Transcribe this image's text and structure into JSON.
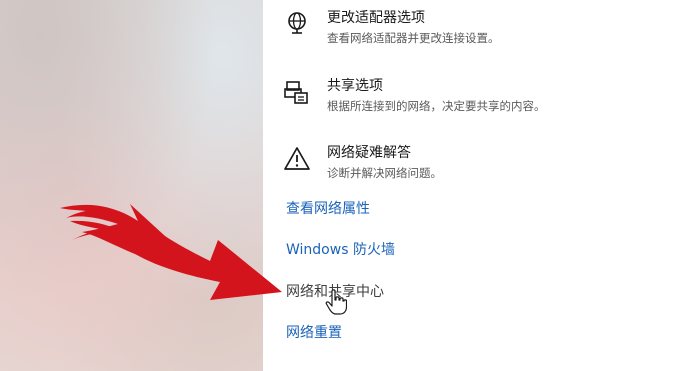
{
  "options": [
    {
      "icon": "network-adapter-globe-icon",
      "title": "更改适配器选项",
      "desc": "查看网络适配器并更改连接设置。"
    },
    {
      "icon": "sharing-printer-icon",
      "title": "共享选项",
      "desc": "根据所连接到的网络，决定要共享的内容。"
    },
    {
      "icon": "warning-triangle-icon",
      "title": "网络疑难解答",
      "desc": "诊断并解决网络问题。"
    }
  ],
  "links": {
    "network_properties": "查看网络属性",
    "windows_firewall": "Windows 防火墙",
    "network_sharing_center": "网络和共享中心",
    "network_reset": "网络重置"
  },
  "colors": {
    "link": "#1b63b9",
    "arrow": "#d4141c"
  },
  "overlays": {
    "arrow_icon": "red-arrow-icon",
    "cursor_icon": "hand-pointer-icon"
  }
}
